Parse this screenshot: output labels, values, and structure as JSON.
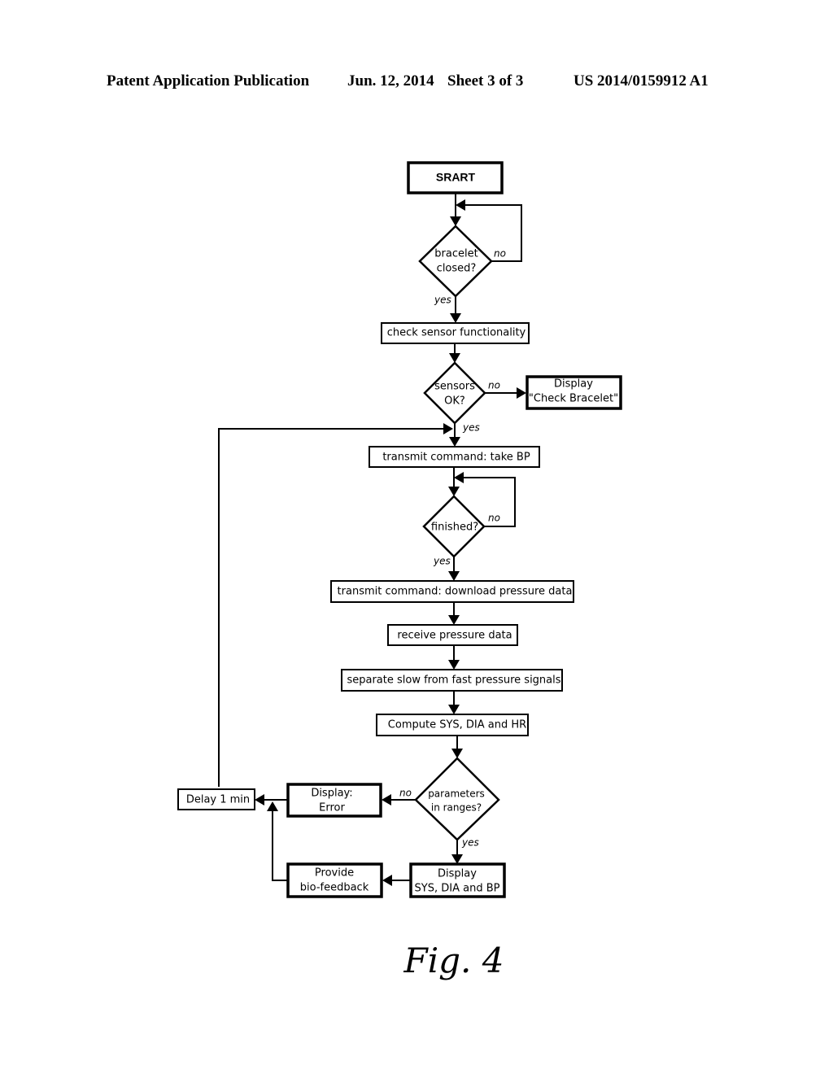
{
  "header": {
    "left": "Patent Application Publication",
    "center": "Jun. 12, 2014",
    "sheet": "Sheet 3 of 3",
    "right": "US 2014/0159912 A1"
  },
  "flowchart": {
    "start": "SRART",
    "bracelet_decision": [
      "bracelet",
      "closed?"
    ],
    "check_sensor": "check sensor functionality",
    "sensors_decision": [
      "sensors",
      "OK?"
    ],
    "display_check": [
      "Display",
      "\"Check Bracelet\""
    ],
    "take_bp": "transmit command: take BP",
    "finished_decision": "finished?",
    "download": "transmit command: download pressure data",
    "receive": "receive pressure data",
    "separate": "separate slow from fast pressure signals",
    "compute": "Compute SYS, DIA and HR",
    "ranges_decision": [
      "parameters",
      "in ranges?"
    ],
    "display_error": [
      "Display:",
      "Error"
    ],
    "delay": "Delay 1 min",
    "display_results": [
      "Display",
      "SYS, DIA and BP"
    ],
    "biofeedback": [
      "Provide",
      "bio-feedback"
    ],
    "labels": {
      "yes": "yes",
      "no": "no"
    }
  },
  "caption": "Fig. 4"
}
